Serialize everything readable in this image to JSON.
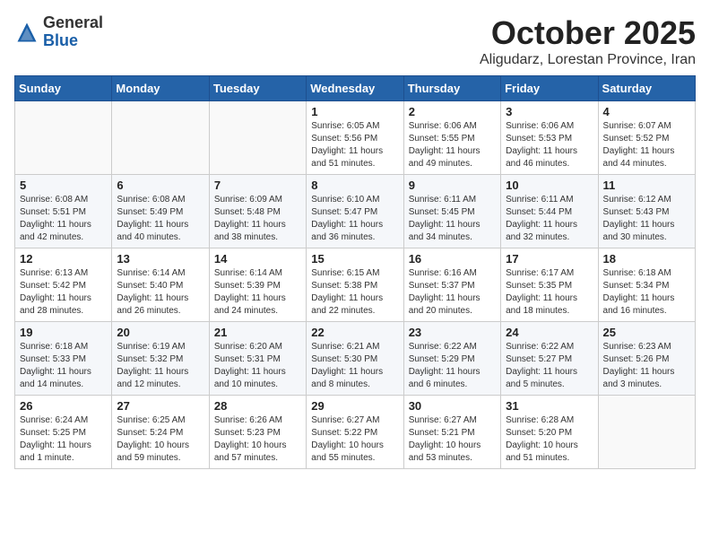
{
  "header": {
    "logo_line1": "General",
    "logo_line2": "Blue",
    "month": "October 2025",
    "location": "Aligudarz, Lorestan Province, Iran"
  },
  "weekdays": [
    "Sunday",
    "Monday",
    "Tuesday",
    "Wednesday",
    "Thursday",
    "Friday",
    "Saturday"
  ],
  "weeks": [
    [
      {
        "day": "",
        "info": ""
      },
      {
        "day": "",
        "info": ""
      },
      {
        "day": "",
        "info": ""
      },
      {
        "day": "1",
        "info": "Sunrise: 6:05 AM\nSunset: 5:56 PM\nDaylight: 11 hours\nand 51 minutes."
      },
      {
        "day": "2",
        "info": "Sunrise: 6:06 AM\nSunset: 5:55 PM\nDaylight: 11 hours\nand 49 minutes."
      },
      {
        "day": "3",
        "info": "Sunrise: 6:06 AM\nSunset: 5:53 PM\nDaylight: 11 hours\nand 46 minutes."
      },
      {
        "day": "4",
        "info": "Sunrise: 6:07 AM\nSunset: 5:52 PM\nDaylight: 11 hours\nand 44 minutes."
      }
    ],
    [
      {
        "day": "5",
        "info": "Sunrise: 6:08 AM\nSunset: 5:51 PM\nDaylight: 11 hours\nand 42 minutes."
      },
      {
        "day": "6",
        "info": "Sunrise: 6:08 AM\nSunset: 5:49 PM\nDaylight: 11 hours\nand 40 minutes."
      },
      {
        "day": "7",
        "info": "Sunrise: 6:09 AM\nSunset: 5:48 PM\nDaylight: 11 hours\nand 38 minutes."
      },
      {
        "day": "8",
        "info": "Sunrise: 6:10 AM\nSunset: 5:47 PM\nDaylight: 11 hours\nand 36 minutes."
      },
      {
        "day": "9",
        "info": "Sunrise: 6:11 AM\nSunset: 5:45 PM\nDaylight: 11 hours\nand 34 minutes."
      },
      {
        "day": "10",
        "info": "Sunrise: 6:11 AM\nSunset: 5:44 PM\nDaylight: 11 hours\nand 32 minutes."
      },
      {
        "day": "11",
        "info": "Sunrise: 6:12 AM\nSunset: 5:43 PM\nDaylight: 11 hours\nand 30 minutes."
      }
    ],
    [
      {
        "day": "12",
        "info": "Sunrise: 6:13 AM\nSunset: 5:42 PM\nDaylight: 11 hours\nand 28 minutes."
      },
      {
        "day": "13",
        "info": "Sunrise: 6:14 AM\nSunset: 5:40 PM\nDaylight: 11 hours\nand 26 minutes."
      },
      {
        "day": "14",
        "info": "Sunrise: 6:14 AM\nSunset: 5:39 PM\nDaylight: 11 hours\nand 24 minutes."
      },
      {
        "day": "15",
        "info": "Sunrise: 6:15 AM\nSunset: 5:38 PM\nDaylight: 11 hours\nand 22 minutes."
      },
      {
        "day": "16",
        "info": "Sunrise: 6:16 AM\nSunset: 5:37 PM\nDaylight: 11 hours\nand 20 minutes."
      },
      {
        "day": "17",
        "info": "Sunrise: 6:17 AM\nSunset: 5:35 PM\nDaylight: 11 hours\nand 18 minutes."
      },
      {
        "day": "18",
        "info": "Sunrise: 6:18 AM\nSunset: 5:34 PM\nDaylight: 11 hours\nand 16 minutes."
      }
    ],
    [
      {
        "day": "19",
        "info": "Sunrise: 6:18 AM\nSunset: 5:33 PM\nDaylight: 11 hours\nand 14 minutes."
      },
      {
        "day": "20",
        "info": "Sunrise: 6:19 AM\nSunset: 5:32 PM\nDaylight: 11 hours\nand 12 minutes."
      },
      {
        "day": "21",
        "info": "Sunrise: 6:20 AM\nSunset: 5:31 PM\nDaylight: 11 hours\nand 10 minutes."
      },
      {
        "day": "22",
        "info": "Sunrise: 6:21 AM\nSunset: 5:30 PM\nDaylight: 11 hours\nand 8 minutes."
      },
      {
        "day": "23",
        "info": "Sunrise: 6:22 AM\nSunset: 5:29 PM\nDaylight: 11 hours\nand 6 minutes."
      },
      {
        "day": "24",
        "info": "Sunrise: 6:22 AM\nSunset: 5:27 PM\nDaylight: 11 hours\nand 5 minutes."
      },
      {
        "day": "25",
        "info": "Sunrise: 6:23 AM\nSunset: 5:26 PM\nDaylight: 11 hours\nand 3 minutes."
      }
    ],
    [
      {
        "day": "26",
        "info": "Sunrise: 6:24 AM\nSunset: 5:25 PM\nDaylight: 11 hours\nand 1 minute."
      },
      {
        "day": "27",
        "info": "Sunrise: 6:25 AM\nSunset: 5:24 PM\nDaylight: 10 hours\nand 59 minutes."
      },
      {
        "day": "28",
        "info": "Sunrise: 6:26 AM\nSunset: 5:23 PM\nDaylight: 10 hours\nand 57 minutes."
      },
      {
        "day": "29",
        "info": "Sunrise: 6:27 AM\nSunset: 5:22 PM\nDaylight: 10 hours\nand 55 minutes."
      },
      {
        "day": "30",
        "info": "Sunrise: 6:27 AM\nSunset: 5:21 PM\nDaylight: 10 hours\nand 53 minutes."
      },
      {
        "day": "31",
        "info": "Sunrise: 6:28 AM\nSunset: 5:20 PM\nDaylight: 10 hours\nand 51 minutes."
      },
      {
        "day": "",
        "info": ""
      }
    ]
  ]
}
